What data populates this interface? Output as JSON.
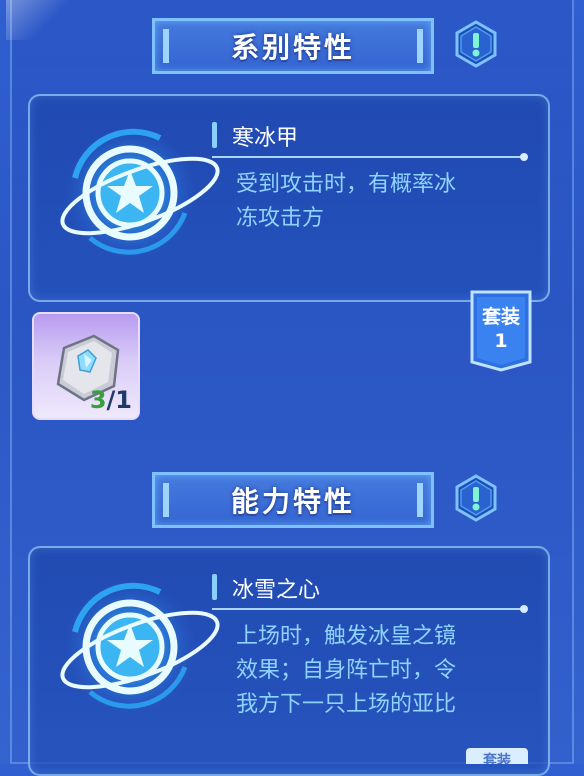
{
  "sections": {
    "series_trait": {
      "header": "系别特性",
      "skill": {
        "title": "寒冰甲",
        "description": "受到攻击时，有概率冰冻攻击方",
        "desc_lines": [
          "受到攻击时，有概率冰",
          "冻攻击方"
        ]
      },
      "set_tag": {
        "label": "套装",
        "number": "1"
      }
    },
    "ability_trait": {
      "header": "能力特性",
      "skill": {
        "title": "冰雪之心",
        "description": "上场时，触发冰皇之镜效果；自身阵亡时，令我方下一只上场的亚比",
        "desc_lines": [
          "上场时，触发冰皇之镜",
          "效果；自身阵亡时，令",
          "我方下一只上场的亚比"
        ]
      },
      "set_tag_partial": "套装"
    }
  },
  "item": {
    "icon": "ice-crystal-stone-icon",
    "count_have": "3",
    "count_sep": "/",
    "count_need": "1"
  },
  "info_icon": "exclamation-icon",
  "colors": {
    "background": "#2f5fd0",
    "accent_text": "#8fd3ff",
    "header_border": "#7fc0ff",
    "count_have": "#37a03a"
  }
}
